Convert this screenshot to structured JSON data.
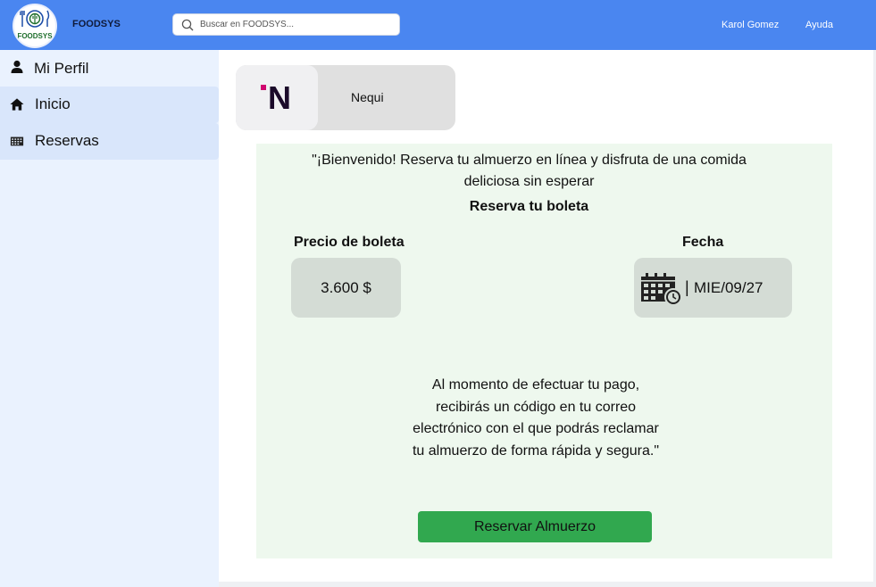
{
  "header": {
    "logo_text": "FOODSYS",
    "brand": "FOODSYS",
    "search_placeholder": "Buscar en FOODSYS...",
    "user": "Karol Gomez",
    "help": "Ayuda",
    "bar_color": "#4a86f0"
  },
  "sidebar": {
    "items": [
      {
        "label": "Mi Perfil",
        "icon": "user-icon"
      },
      {
        "label": "Inicio",
        "icon": "home-icon"
      },
      {
        "label": "Reservas",
        "icon": "calendar-grid-icon"
      }
    ]
  },
  "payment": {
    "logo_letter": "N",
    "name": "Nequi"
  },
  "main": {
    "welcome_line1": "\"¡Bienvenido! Reserva tu almuerzo en línea y disfruta de una comida",
    "welcome_line2": "deliciosa sin esperar",
    "reserve_title": "Reserva tu boleta",
    "price_title": "Precio de boleta",
    "price_value": "3.600 $",
    "date_title": "Fecha",
    "date_separator": "|",
    "date_value": "MIE/09/27",
    "note_lines": [
      "Al momento de efectuar tu pago,",
      "recibirás un código en tu correo",
      "electrónico con el que podrás reclamar",
      "tu almuerzo de forma rápida y segura.\""
    ],
    "reserve_button": "Reservar Almuerzo",
    "accent_color": "#31a84f"
  }
}
